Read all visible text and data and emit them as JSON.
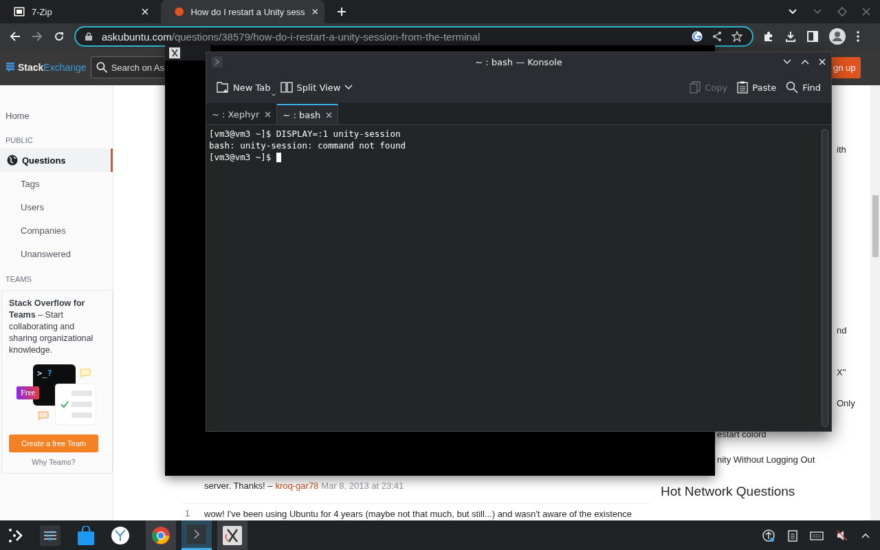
{
  "browser": {
    "tabs": [
      {
        "title": "7-Zip",
        "kind": "zip",
        "selected": false
      },
      {
        "title": "How do I restart a Unity sess",
        "kind": "ask",
        "selected": true
      }
    ],
    "url_host": "askubuntu.com",
    "url_path": "/questions/38579/how-do-i-restart-a-unity-session-from-the-terminal"
  },
  "site": {
    "brand": [
      "Stack",
      "Exchange"
    ],
    "search_placeholder": "Search on As",
    "signup": "gn up",
    "nav": [
      {
        "label": "Home",
        "kind": "top",
        "selected": false
      },
      {
        "label": "PUBLIC",
        "kind": "heading"
      },
      {
        "label": "Questions",
        "kind": "primary",
        "selected": true
      },
      {
        "label": "Tags",
        "kind": "sub",
        "selected": false
      },
      {
        "label": "Users",
        "kind": "sub",
        "selected": false
      },
      {
        "label": "Companies",
        "kind": "sub",
        "selected": false
      },
      {
        "label": "Unanswered",
        "kind": "sub",
        "selected": false
      },
      {
        "label": "TEAMS",
        "kind": "heading"
      }
    ],
    "teams": {
      "text": "**Stack Overflow for Teams** – Start collaborating and sharing organizational knowledge.",
      "prompt": ">_",
      "mark": "?",
      "badge": "Free",
      "button": "Create a free Team",
      "link": "Why Teams?"
    },
    "comments": [
      {
        "text": "server. Thanks! –",
        "user": "kroq-gar78",
        "time": "Mar 8, 2013 at 23:41"
      },
      {
        "score": "1",
        "text": "wow! I've been using Ubuntu for 4 years (maybe not that much, but still...) and wasn't aware of the existence"
      }
    ],
    "right_fragments": [
      {
        "text": "ith",
        "kind": "edge"
      },
      {
        "text": "nd",
        "kind": "edge"
      },
      {
        "text": "X\"",
        "kind": "edge"
      },
      {
        "text": "Only",
        "kind": "edge"
      },
      {
        "text": "estart colord",
        "kind": "link"
      },
      {
        "text": "nity Without Logging Out",
        "kind": "link"
      }
    ],
    "hot_title": "Hot Network Questions"
  },
  "konsole": {
    "title": "~ : bash — Konsole",
    "tools_left": [
      {
        "label": "New Tab",
        "kind": "newtab"
      },
      {
        "label": "Split View",
        "kind": "split"
      }
    ],
    "tools_right": [
      {
        "label": "Copy",
        "kind": "copy",
        "disabled": true
      },
      {
        "label": "Paste",
        "kind": "paste",
        "disabled": false
      },
      {
        "label": "Find",
        "kind": "find",
        "disabled": false
      }
    ],
    "tabs": [
      {
        "label": "~ : Xephyr",
        "selected": false
      },
      {
        "label": "~ : bash",
        "selected": true
      }
    ],
    "lines": [
      "[vm3@vm3 ~]$ DISPLAY=:1 unity-session",
      "bash: unity-session: command not found",
      "[vm3@vm3 ~]$ "
    ]
  }
}
